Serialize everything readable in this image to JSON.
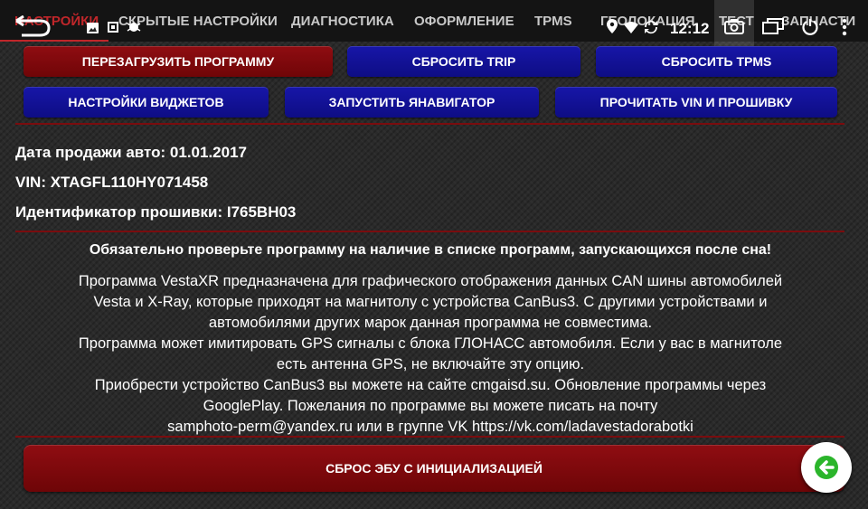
{
  "tabs": [
    {
      "label": "НАСТРОЙКИ",
      "active": true
    },
    {
      "label": "СКРЫТЫЕ НАСТРОЙКИ"
    },
    {
      "label": "ДИАГНОСТИКА"
    },
    {
      "label": "ОФОРМЛЕНИЕ"
    },
    {
      "label": "TPMS"
    },
    {
      "label": "ГЕОЛОКАЦИЯ"
    },
    {
      "label": "ТЕСТ"
    },
    {
      "label": "ЗАПЧАСТИ"
    }
  ],
  "status_bar": {
    "time": "12:12",
    "icons": [
      "back-icon",
      "image-icon",
      "settings-icon",
      "bug-icon",
      "location-icon",
      "wifi-icon",
      "camera-icon",
      "window-icon",
      "power-icon",
      "menu-icon"
    ]
  },
  "buttons": {
    "restart": "ПЕРЕЗАГРУЗИТЬ ПРОГРАММУ",
    "reset_trip": "СБРОСИТЬ TRIP",
    "reset_tpms": "СБРОСИТЬ TPMS",
    "widget_settings": "НАСТРОЙКИ ВИДЖЕТОВ",
    "launch_navigator": "ЗАПУСТИТЬ ЯНАВИГАТОР",
    "read_vin": "ПРОЧИТАТЬ VIN И ПРОШИВКУ",
    "ecu_reset": "СБРОС ЭБУ С ИНИЦИАЛИЗАЦИЕЙ"
  },
  "info": {
    "sale_date": "Дата продажи авто: 01.01.2017",
    "vin": "VIN: XTAGFL110HY071458",
    "firmware": "Идентификатор прошивки: I765BH03"
  },
  "warning": "Обязательно проверьте программу на наличие в списке программ, запускающихся после сна!",
  "description": [
    "Программа VestaXR предназначена для графического отображения данных CAN шины автомобилей",
    "Vesta и X-Ray, которые приходят на магнитолу с устройства CanBus3. С другими устройствами и",
    "автомобилями других марок данная программа не совместима.",
    "Программа может имитировать GPS сигналы с блока ГЛОНАСС автомобиля. Если у вас в магнитоле",
    "есть антенна GPS, не включайте эту опцию.",
    "Приобрести устройство CanBus3 вы можете на сайте cmgaisd.su. Обновление программы через",
    "GooglePlay. Пожелания по программе вы можете писать на почту",
    "samphoto-perm@yandex.ru или в группе VK https://vk.com/ladavestadorabotki"
  ],
  "colors": {
    "accent_red": "#c0262a",
    "button_red": "#7f0a0d",
    "button_blue": "#1312a0",
    "fab_arrow": "#2bb52b"
  }
}
